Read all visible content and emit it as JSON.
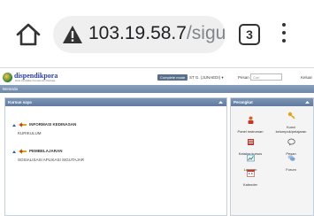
{
  "browser": {
    "url_host": "103.19.58.7",
    "url_path": "/sigutaj",
    "tab_count": "3"
  },
  "site": {
    "logo_text": "dispendikpora",
    "logo_subtitle": "Dinas Pendidikan Pemuda dan Olahraga",
    "complete_button": "Complete mode",
    "user_menu": "ST G. (JUNAEDI) ▾",
    "pesan": "Pesan ▾",
    "search_placeholder": "Cari",
    "logout": "Keluar",
    "navbar_text": "Beranda"
  },
  "main_block": {
    "title": "Kursus saya",
    "categories": [
      {
        "label": "INFORMASI KEDINASAN",
        "course": "KURIKULUM"
      },
      {
        "label": "PEMBELAJARAN",
        "course": "SOSIALISASI APLIKASI SIGUTAJAR"
      }
    ]
  },
  "side_block": {
    "title": "Perangkat",
    "tools": [
      {
        "label": "Panel instruman",
        "icon": "instrument-panel-icon",
        "color": "#d9622b"
      },
      {
        "label": "Kunci kelompok/pelajaran",
        "icon": "key-icon",
        "color": "#e0a51e"
      },
      {
        "label": "Katalog kursus",
        "icon": "catalog-icon",
        "color": "#c0392b"
      },
      {
        "label": "Pesan",
        "icon": "message-icon",
        "color": "#555555"
      },
      {
        "label": "Laporan",
        "icon": "report-icon",
        "color": "#3c8dbc"
      },
      {
        "label": "Forum",
        "icon": "forum-icon",
        "color": "#7fa3cf"
      },
      {
        "label": "Kalender",
        "icon": "calendar-icon",
        "color": "#c0392b"
      }
    ]
  }
}
